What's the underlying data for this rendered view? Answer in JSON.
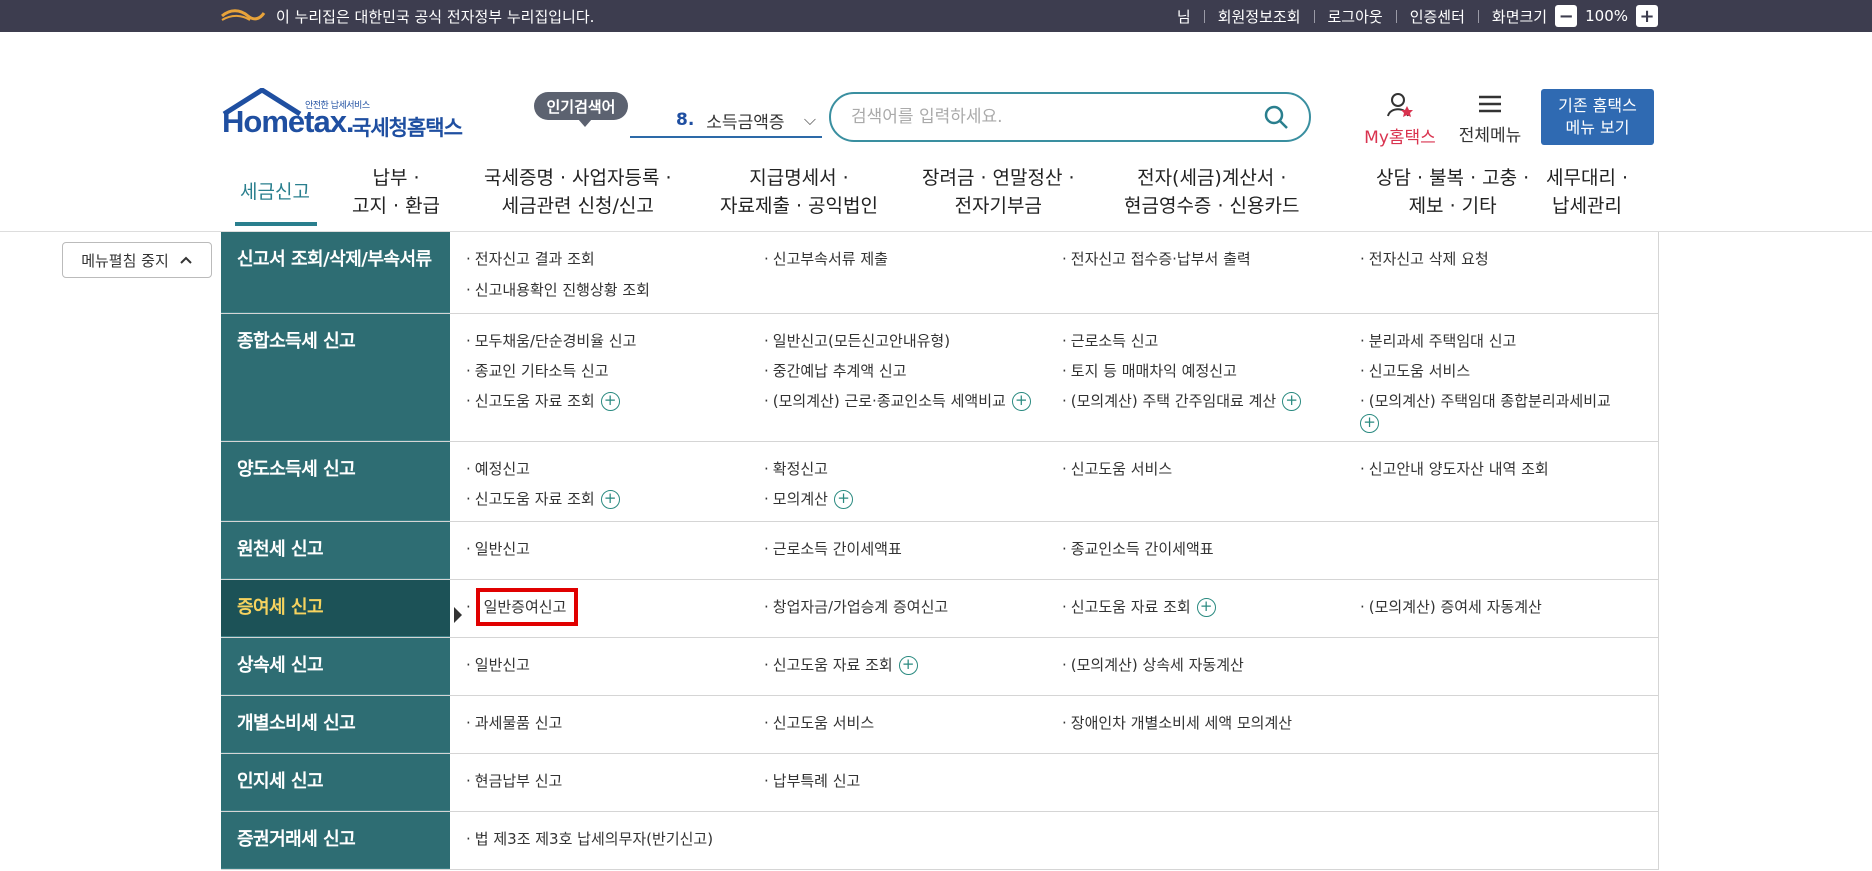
{
  "gov_bar": {
    "notice": "이 누리집은 대한민국 공식 전자정부 누리집입니다.",
    "links": [
      "님",
      "회원정보조회",
      "로그아웃",
      "인증센터"
    ],
    "zoom_label": "화면크기",
    "zoom_minus": "−",
    "zoom_value": "100%",
    "zoom_plus": "+"
  },
  "header": {
    "logo_small": "안전한 납세서비스",
    "logo_main": "Hometax.",
    "logo_kr": "국세청홈택스",
    "popular_label": "인기검색어",
    "rank_num": "8.",
    "rank_term": "소득금액증",
    "search_placeholder": "검색어를 입력하세요.",
    "my_label": "My홈택스",
    "all_menu_label": "전체메뉴",
    "old_home_line1": "기존 홈택스",
    "old_home_line2": "메뉴 보기"
  },
  "gnb": [
    {
      "line1": "세금신고",
      "line2": ""
    },
    {
      "line1": "납부 ·",
      "line2": "고지 · 환급"
    },
    {
      "line1": "국세증명 · 사업자등록 ·",
      "line2": "세금관련 신청/신고"
    },
    {
      "line1": "지급명세서 ·",
      "line2": "자료제출 · 공익법인"
    },
    {
      "line1": "장려금 · 연말정산 ·",
      "line2": "전자기부금"
    },
    {
      "line1": "전자(세금)계산서 ·",
      "line2": "현금영수증 · 신용카드"
    },
    {
      "line1": "상담 · 불복 · 고충 ·",
      "line2": "제보 · 기타"
    },
    {
      "line1": "세무대리 ·",
      "line2": "납세관리"
    }
  ],
  "toggle_label": "메뉴펼침 중지",
  "menu": [
    {
      "cat": "신고서 조회/삭제/부속서류",
      "items": [
        "전자신고 결과 조회",
        "신고부속서류 제출",
        "전자신고 접수증·납부서 출력",
        "전자신고 삭제 요청",
        "신고내용확인 진행상황 조회"
      ]
    },
    {
      "cat": "종합소득세 신고",
      "items": [
        "모두채움/단순경비율 신고",
        "일반신고(모든신고안내유형)",
        "근로소득 신고",
        "분리과세 주택임대 신고",
        "종교인 기타소득 신고",
        "중간예납 추계액 신고",
        "토지 등 매매차익 예정신고",
        "신고도움 서비스",
        "신고도움 자료 조회",
        "(모의계산) 근로·종교인소득 세액비교",
        "(모의계산) 주택 간주임대료 계산",
        "(모의계산) 주택임대 종합분리과세비교"
      ]
    },
    {
      "cat": "양도소득세 신고",
      "items": [
        "예정신고",
        "확정신고",
        "신고도움 서비스",
        "신고안내 양도자산 내역 조회",
        "신고도움 자료 조회",
        "모의계산"
      ]
    },
    {
      "cat": "원천세 신고",
      "items": [
        "일반신고",
        "근로소득 간이세액표",
        "종교인소득 간이세액표"
      ]
    },
    {
      "cat": "증여세 신고",
      "items": [
        "일반증여신고",
        "창업자금/가업승계 증여신고",
        "신고도움 자료 조회",
        "(모의계산) 증여세 자동계산"
      ]
    },
    {
      "cat": "상속세 신고",
      "items": [
        "일반신고",
        "신고도움 자료 조회",
        "(모의계산) 상속세 자동계산"
      ]
    },
    {
      "cat": "개별소비세 신고",
      "items": [
        "과세물품 신고",
        "신고도움 서비스",
        "장애인차 개별소비세 세액 모의계산"
      ]
    },
    {
      "cat": "인지세 신고",
      "items": [
        "현금납부 신고",
        "납부특례 신고"
      ]
    },
    {
      "cat": "증권거래세 신고",
      "items": [
        "법 제3조 제3호 납세의무자(반기신고)"
      ]
    }
  ],
  "colors": {
    "gov_bar": "#3d3d4f",
    "teal": "#2e6d73",
    "active_cat": "#1c5257",
    "active_text": "#f6d35f",
    "highlight": "#e00000",
    "brand_blue": "#2f6ab2"
  }
}
